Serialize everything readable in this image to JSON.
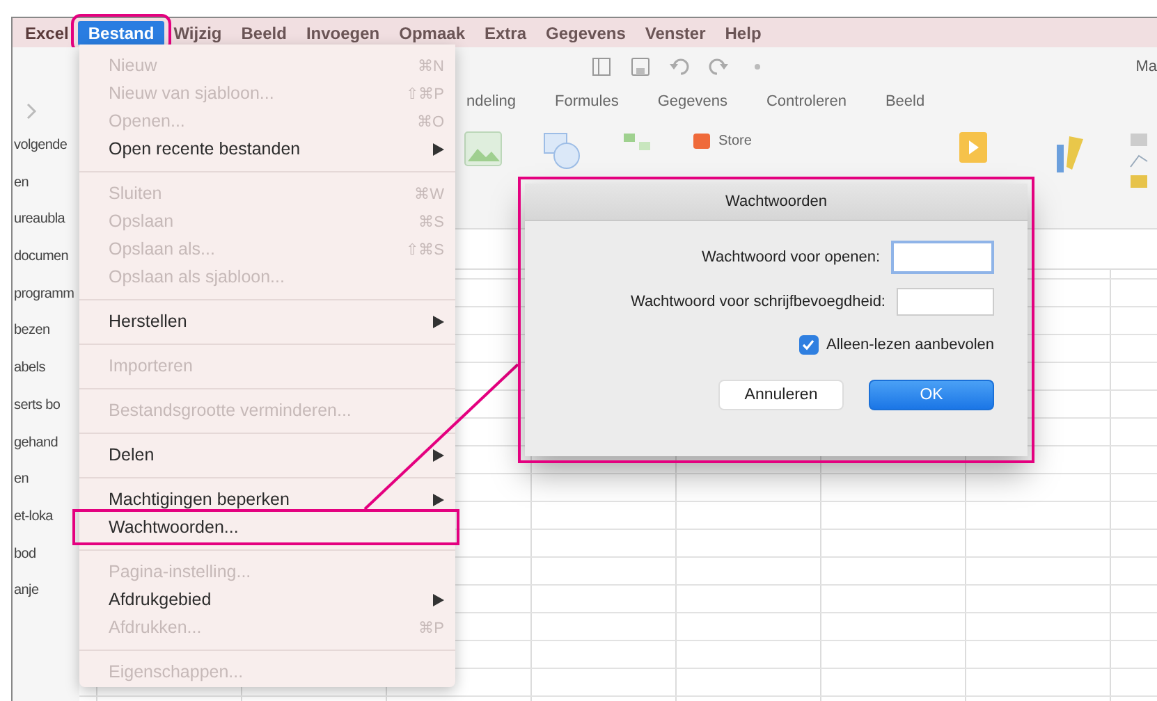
{
  "menubar": [
    {
      "label": "Excel",
      "kind": "app",
      "selected": false,
      "annotated": false
    },
    {
      "label": "Bestand",
      "kind": "menu",
      "selected": true,
      "annotated": true
    },
    {
      "label": "Wijzig",
      "kind": "menu",
      "selected": false,
      "annotated": false
    },
    {
      "label": "Beeld",
      "kind": "menu",
      "selected": false,
      "annotated": false
    },
    {
      "label": "Invoegen",
      "kind": "menu",
      "selected": false,
      "annotated": false
    },
    {
      "label": "Opmaak",
      "kind": "menu",
      "selected": false,
      "annotated": false
    },
    {
      "label": "Extra",
      "kind": "menu",
      "selected": false,
      "annotated": false
    },
    {
      "label": "Gegevens",
      "kind": "menu",
      "selected": false,
      "annotated": false
    },
    {
      "label": "Venster",
      "kind": "menu",
      "selected": false,
      "annotated": false
    },
    {
      "label": "Help",
      "kind": "menu",
      "selected": false,
      "annotated": false
    }
  ],
  "excel": {
    "title": "Ma",
    "ribbon_tabs": [
      "ndeling",
      "Formules",
      "Gegevens",
      "Controleren",
      "Beeld"
    ],
    "store_button": "Store"
  },
  "sidebar": [
    "volgende",
    "en",
    "ureaubla",
    "documen",
    "programm",
    "bezen",
    "abels",
    "serts bo",
    "gehand",
    "en",
    "et-loka",
    "bod",
    "anje"
  ],
  "file_menu": [
    {
      "kind": "item",
      "label": "Nieuw",
      "shortcut": "⌘N",
      "disabled": true,
      "submenu": false,
      "annotated": false
    },
    {
      "kind": "item",
      "label": "Nieuw van sjabloon...",
      "shortcut": "⇧⌘P",
      "disabled": true,
      "submenu": false,
      "annotated": false
    },
    {
      "kind": "item",
      "label": "Openen...",
      "shortcut": "⌘O",
      "disabled": true,
      "submenu": false,
      "annotated": false
    },
    {
      "kind": "item",
      "label": "Open recente bestanden",
      "disabled": false,
      "submenu": true,
      "annotated": false
    },
    {
      "kind": "separator"
    },
    {
      "kind": "item",
      "label": "Sluiten",
      "shortcut": "⌘W",
      "disabled": true,
      "submenu": false,
      "annotated": false
    },
    {
      "kind": "item",
      "label": "Opslaan",
      "shortcut": "⌘S",
      "disabled": true,
      "submenu": false,
      "annotated": false
    },
    {
      "kind": "item",
      "label": "Opslaan als...",
      "shortcut": "⇧⌘S",
      "disabled": true,
      "submenu": false,
      "annotated": false
    },
    {
      "kind": "item",
      "label": "Opslaan als sjabloon...",
      "disabled": true,
      "submenu": false,
      "annotated": false
    },
    {
      "kind": "separator"
    },
    {
      "kind": "item",
      "label": "Herstellen",
      "disabled": false,
      "submenu": true,
      "annotated": false
    },
    {
      "kind": "separator"
    },
    {
      "kind": "item",
      "label": "Importeren",
      "disabled": true,
      "submenu": false,
      "annotated": false
    },
    {
      "kind": "separator"
    },
    {
      "kind": "item",
      "label": "Bestandsgrootte verminderen...",
      "disabled": true,
      "submenu": false,
      "annotated": false
    },
    {
      "kind": "separator"
    },
    {
      "kind": "item",
      "label": "Delen",
      "disabled": false,
      "submenu": true,
      "annotated": false
    },
    {
      "kind": "separator"
    },
    {
      "kind": "item",
      "label": "Machtigingen beperken",
      "disabled": false,
      "submenu": true,
      "annotated": false
    },
    {
      "kind": "item",
      "label": "Wachtwoorden...",
      "disabled": false,
      "submenu": false,
      "annotated": true
    },
    {
      "kind": "separator"
    },
    {
      "kind": "item",
      "label": "Pagina-instelling...",
      "disabled": true,
      "submenu": false,
      "annotated": false
    },
    {
      "kind": "item",
      "label": "Afdrukgebied",
      "disabled": false,
      "submenu": true,
      "annotated": false
    },
    {
      "kind": "item",
      "label": "Afdrukken...",
      "shortcut": "⌘P",
      "disabled": true,
      "submenu": false,
      "annotated": false
    },
    {
      "kind": "separator"
    },
    {
      "kind": "item",
      "label": "Eigenschappen...",
      "disabled": true,
      "submenu": false,
      "annotated": false
    }
  ],
  "dialog": {
    "title": "Wachtwoorden",
    "annotated": true,
    "fields": [
      {
        "label": "Wachtwoord voor openen:",
        "focused": true
      },
      {
        "label": "Wachtwoord voor schrijfbevoegdheid:",
        "focused": false
      }
    ],
    "checkbox": {
      "label": "Alleen-lezen aanbevolen",
      "checked": true
    },
    "buttons": [
      {
        "label": "Annuleren",
        "default": false
      },
      {
        "label": "OK",
        "default": true
      }
    ]
  }
}
